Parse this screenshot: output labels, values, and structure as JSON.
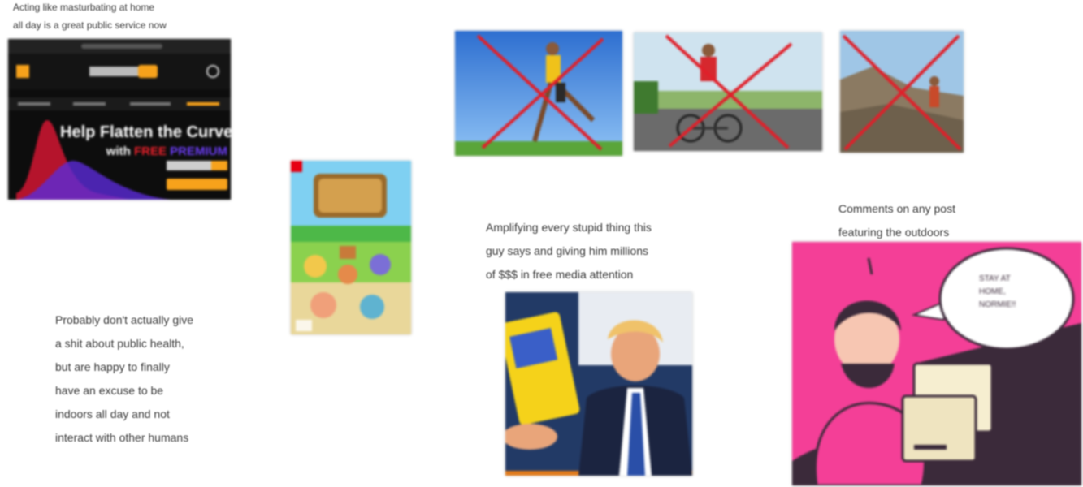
{
  "captions": {
    "top_left": "Acting like masturbating at home\nall day is a great public service now",
    "bottom_left": "Probably don't actually give\na shit about public health,\nbut are happy to finally\nhave an excuse to be\nindoors all day and not\ninteract with other humans",
    "middle": "Amplifying every stupid thing this\nguy says and giving him millions\nof $$$ in free media attention",
    "right": "Comments on any post\nfeaturing the outdoors"
  },
  "phone_screenshot": {
    "headline": "Help Flatten the Curve",
    "sub_prefix": "with",
    "sub_free": "FREE",
    "sub_premium": "PREMIUM",
    "colors": {
      "accent": "#f7a21b",
      "free": "#e8202a",
      "premium": "#5b2bd8"
    }
  },
  "speech_bubble": {
    "text": "STAY AT\nHOME,\nNORMIE!!"
  },
  "cross_color": "#e0202a",
  "background_color": "#f43f97"
}
